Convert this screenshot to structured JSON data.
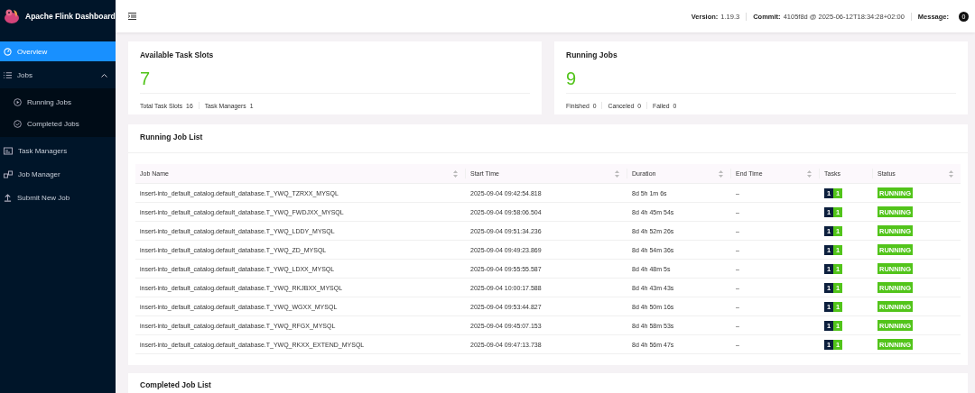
{
  "sidebar": {
    "title": "Apache Flink Dashboard",
    "items": [
      {
        "label": "Overview",
        "selected": true
      },
      {
        "label": "Jobs",
        "selected": false,
        "expanded": true,
        "children": [
          {
            "label": "Running Jobs",
            "selected": false
          },
          {
            "label": "Completed Jobs",
            "selected": false
          }
        ]
      },
      {
        "label": "Task Managers",
        "selected": false
      },
      {
        "label": "Job Manager",
        "selected": false
      },
      {
        "label": "Submit New Job",
        "selected": false
      }
    ]
  },
  "header": {
    "version_label": "Version:",
    "version": "1.19.3",
    "commit_label": "Commit:",
    "commit": "4105f8d @ 2025-06-12T18:34:28+02:00",
    "message_label": "Message:",
    "message_count": "0"
  },
  "cards": [
    {
      "title": "Available Task Slots",
      "value": "7",
      "stats": [
        {
          "label": "Total Task Slots",
          "value": "16"
        },
        {
          "label": "Task Managers",
          "value": "1"
        }
      ]
    },
    {
      "title": "Running Jobs",
      "value": "9",
      "stats": [
        {
          "label": "Finished",
          "value": "0"
        },
        {
          "label": "Canceled",
          "value": "0"
        },
        {
          "label": "Failed",
          "value": "0"
        }
      ]
    }
  ],
  "running_job_list": {
    "title": "Running Job List",
    "columns": [
      {
        "label": "Job Name",
        "sortable": true
      },
      {
        "label": "Start Time",
        "sortable": true
      },
      {
        "label": "Duration",
        "sortable": true
      },
      {
        "label": "End Time",
        "sortable": true
      },
      {
        "label": "Tasks",
        "sortable": false
      },
      {
        "label": "Status",
        "sortable": true
      }
    ],
    "rows": [
      {
        "name": "insert-into_default_catalog.default_database.T_YWQ_TZRXX_MYSQL",
        "start": "2025-09-04 09:42:54.818",
        "duration": "8d 5h 1m 6s",
        "end": "–",
        "tasks": [
          "1",
          "1"
        ],
        "status": "RUNNING"
      },
      {
        "name": "insert-into_default_catalog.default_database.T_YWQ_FWDJXX_MYSQL",
        "start": "2025-09-04 09:58:06.504",
        "duration": "8d 4h 45m 54s",
        "end": "–",
        "tasks": [
          "1",
          "1"
        ],
        "status": "RUNNING"
      },
      {
        "name": "insert-into_default_catalog.default_database.T_YWQ_LDDY_MYSQL",
        "start": "2025-09-04 09:51:34.236",
        "duration": "8d 4h 52m 26s",
        "end": "–",
        "tasks": [
          "1",
          "1"
        ],
        "status": "RUNNING"
      },
      {
        "name": "insert-into_default_catalog.default_database.T_YWQ_ZD_MYSQL",
        "start": "2025-09-04 09:49:23.869",
        "duration": "8d 4h 54m 36s",
        "end": "–",
        "tasks": [
          "1",
          "1"
        ],
        "status": "RUNNING"
      },
      {
        "name": "insert-into_default_catalog.default_database.T_YWQ_LDXX_MYSQL",
        "start": "2025-09-04 09:55:55.587",
        "duration": "8d 4h 48m 5s",
        "end": "–",
        "tasks": [
          "1",
          "1"
        ],
        "status": "RUNNING"
      },
      {
        "name": "insert-into_default_catalog.default_database.T_YWQ_RKJBXX_MYSQL",
        "start": "2025-09-04 10:00:17.588",
        "duration": "8d 4h 43m 43s",
        "end": "–",
        "tasks": [
          "1",
          "1"
        ],
        "status": "RUNNING"
      },
      {
        "name": "insert-into_default_catalog.default_database.T_YWQ_WGXX_MYSQL",
        "start": "2025-09-04 09:53:44.827",
        "duration": "8d 4h 50m 16s",
        "end": "–",
        "tasks": [
          "1",
          "1"
        ],
        "status": "RUNNING"
      },
      {
        "name": "insert-into_default_catalog.default_database.T_YWQ_RFGX_MYSQL",
        "start": "2025-09-04 09:45:07.153",
        "duration": "8d 4h 58m 53s",
        "end": "–",
        "tasks": [
          "1",
          "1"
        ],
        "status": "RUNNING"
      },
      {
        "name": "insert-into_default_catalog.default_database.T_YWQ_RKXX_EXTEND_MYSQL",
        "start": "2025-09-04 09:47:13.738",
        "duration": "8d 4h 56m 47s",
        "end": "–",
        "tasks": [
          "1",
          "1"
        ],
        "status": "RUNNING"
      }
    ]
  },
  "completed_job_list": {
    "title": "Completed Job List"
  }
}
